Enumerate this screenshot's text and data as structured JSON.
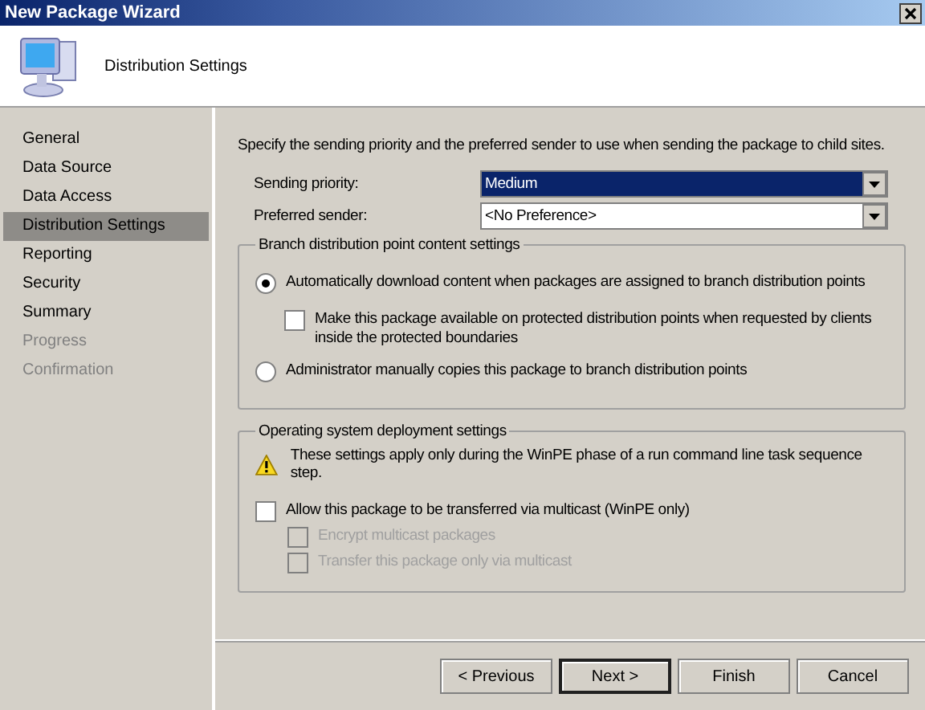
{
  "window": {
    "title": "New Package Wizard"
  },
  "header": {
    "title": "Distribution Settings"
  },
  "sidebar": {
    "items": [
      {
        "label": "General",
        "selected": false,
        "disabled": false
      },
      {
        "label": "Data Source",
        "selected": false,
        "disabled": false
      },
      {
        "label": "Data Access",
        "selected": false,
        "disabled": false
      },
      {
        "label": "Distribution Settings",
        "selected": true,
        "disabled": false
      },
      {
        "label": "Reporting",
        "selected": false,
        "disabled": false
      },
      {
        "label": "Security",
        "selected": false,
        "disabled": false
      },
      {
        "label": "Summary",
        "selected": false,
        "disabled": false
      },
      {
        "label": "Progress",
        "selected": false,
        "disabled": true
      },
      {
        "label": "Confirmation",
        "selected": false,
        "disabled": true
      }
    ]
  },
  "intro": "Specify the sending priority and the preferred sender to use when sending the package to child sites.",
  "fields": [
    {
      "label": "Sending priority:",
      "value": "Medium",
      "focused": true
    },
    {
      "label": "Preferred sender:",
      "value": "<No Preference>",
      "focused": false
    }
  ],
  "branch_group": {
    "title": "Branch distribution point content settings",
    "options": [
      {
        "label": "Automatically download content when packages are assigned to branch distribution points",
        "selected": true,
        "children": [
          {
            "label": "Make this package available on protected distribution points when requested by clients inside the protected boundaries",
            "checked": false,
            "disabled": false
          }
        ]
      },
      {
        "label": "Administrator manually copies this package to branch distribution points",
        "selected": false
      }
    ]
  },
  "osd_group": {
    "title": "Operating system deployment settings",
    "warning": "These settings apply only during the WinPE phase of a run command line task sequence step.",
    "multicast": {
      "label": "Allow this package to be transferred via multicast (WinPE only)",
      "checked": false,
      "disabled": false,
      "children": [
        {
          "label": "Encrypt multicast packages",
          "checked": false,
          "disabled": true
        },
        {
          "label": "Transfer this package only via multicast",
          "checked": false,
          "disabled": true
        }
      ]
    }
  },
  "buttons": [
    {
      "label": "< Previous",
      "default": false
    },
    {
      "label": "Next >",
      "default": true
    },
    {
      "label": "Finish",
      "default": false
    },
    {
      "label": "Cancel",
      "default": false
    }
  ]
}
